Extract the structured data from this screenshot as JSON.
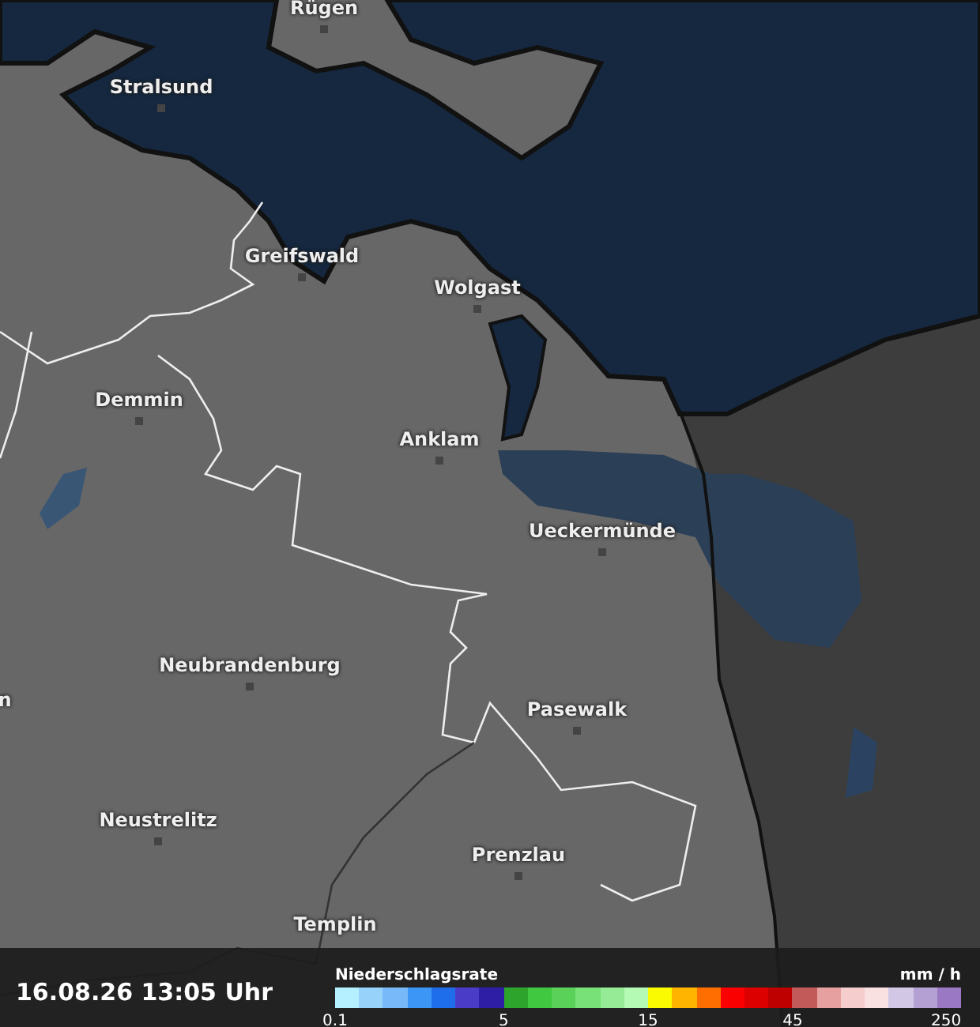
{
  "map": {
    "places": [
      {
        "name": "Rügen"
      },
      {
        "name": "Stralsund"
      },
      {
        "name": "Greifswald"
      },
      {
        "name": "Wolgast"
      },
      {
        "name": "Demmin"
      },
      {
        "name": "Anklam"
      },
      {
        "name": "Ueckermünde"
      },
      {
        "name": "n"
      },
      {
        "name": "Neubrandenburg"
      },
      {
        "name": "Pasewalk"
      },
      {
        "name": "Neustrelitz"
      },
      {
        "name": "Prenzlau"
      },
      {
        "name": "Templin"
      }
    ]
  },
  "footer": {
    "timestamp": "16.08.26 13:05 Uhr",
    "legend": {
      "title": "Niederschlagsrate",
      "unit": "mm / h",
      "swatches": [
        {
          "color": "#b4f0ff",
          "label": "0.1"
        },
        {
          "color": "#96d2fa"
        },
        {
          "color": "#78b9fa"
        },
        {
          "color": "#3c96f5"
        },
        {
          "color": "#1e6eeb"
        },
        {
          "color": "#4b3cc8"
        },
        {
          "color": "#2d1ea5"
        },
        {
          "color": "#2da52d",
          "label": "5"
        },
        {
          "color": "#41c841"
        },
        {
          "color": "#5ad25a"
        },
        {
          "color": "#78e178"
        },
        {
          "color": "#96eb96"
        },
        {
          "color": "#b4fab4"
        },
        {
          "color": "#fafa00",
          "label": "15"
        },
        {
          "color": "#ffb400"
        },
        {
          "color": "#ff6e00"
        },
        {
          "color": "#fa0000"
        },
        {
          "color": "#dc0000"
        },
        {
          "color": "#be0000"
        },
        {
          "color": "#c35a5a",
          "label": "45"
        },
        {
          "color": "#e6a0a0"
        },
        {
          "color": "#f5cdcd"
        },
        {
          "color": "#fae1e1"
        },
        {
          "color": "#d2c8e6"
        },
        {
          "color": "#b4a0d2"
        },
        {
          "color": "#9b78c3",
          "label": "250"
        }
      ]
    }
  }
}
